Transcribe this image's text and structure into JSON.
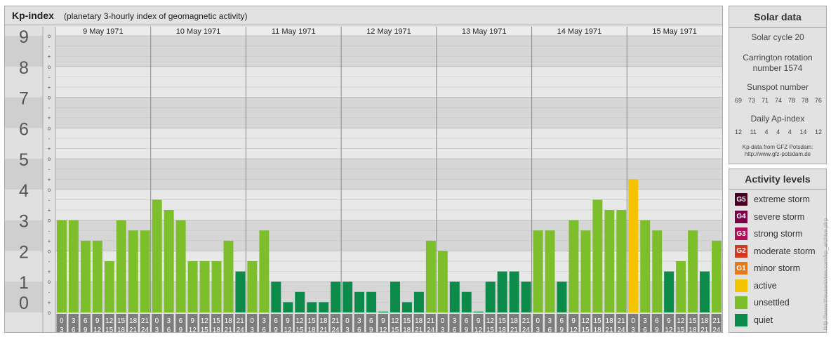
{
  "header": {
    "title": "Kp-index",
    "subtitle": "(planetary 3-hourly index of geomagnetic activity)"
  },
  "chart_data": {
    "type": "bar",
    "title": "Kp-index",
    "subtitle": "(planetary 3-hourly index of geomagnetic activity)",
    "ylim": [
      0,
      9
    ],
    "y_ticks": [
      "0",
      "1",
      "2",
      "3",
      "4",
      "5",
      "6",
      "7",
      "8",
      "9"
    ],
    "minor_tick_labels": [
      "o",
      "+",
      "-"
    ],
    "days": [
      "9 May 1971",
      "10 May 1971",
      "11 May 1971",
      "12 May 1971",
      "13 May 1971",
      "14 May 1971",
      "15 May 1971"
    ],
    "interval_start_labels": [
      "0",
      "3",
      "6",
      "9",
      "12",
      "15",
      "18",
      "21"
    ],
    "interval_end_labels": [
      "3",
      "6",
      "9",
      "12",
      "15",
      "18",
      "21",
      "24"
    ],
    "values": [
      3.0,
      3.0,
      2.333,
      2.333,
      1.667,
      3.0,
      2.667,
      2.667,
      3.667,
      3.333,
      3.0,
      1.667,
      1.667,
      1.667,
      2.333,
      1.333,
      1.667,
      2.667,
      1.0,
      0.333,
      0.667,
      0.333,
      0.333,
      1.0,
      1.0,
      0.667,
      0.667,
      0.0,
      1.0,
      0.333,
      0.667,
      2.333,
      2.0,
      1.0,
      0.667,
      0.0,
      1.0,
      1.333,
      1.333,
      1.0,
      2.667,
      2.667,
      1.0,
      3.0,
      2.667,
      3.667,
      3.333,
      3.333,
      4.333,
      3.0,
      2.667,
      1.333,
      1.667,
      2.667,
      1.333,
      2.333
    ],
    "level_colors": {
      "quiet": "#0b8a4a",
      "unsettled": "#7dbf2a",
      "active": "#f5c400"
    },
    "grid": true
  },
  "solar": {
    "title": "Solar data",
    "cycle": "Solar cycle 20",
    "carrington_line1": "Carrington rotation",
    "carrington_line2": "number 1574",
    "sunspot_title": "Sunspot number",
    "sunspot_values": [
      "69",
      "73",
      "71",
      "74",
      "78",
      "78",
      "76"
    ],
    "ap_title": "Daily Ap-index",
    "ap_values": [
      "12",
      "11",
      "4",
      "4",
      "4",
      "14",
      "12"
    ],
    "source_line1": "Kp-data from GFZ Potsdam:",
    "source_line2": "http://www.gfz-potsdam.de"
  },
  "activity": {
    "title": "Activity levels",
    "levels": [
      {
        "code": "G5",
        "label": "extreme storm",
        "color": "#4a0024"
      },
      {
        "code": "G4",
        "label": "severe storm",
        "color": "#7a0048"
      },
      {
        "code": "G3",
        "label": "strong storm",
        "color": "#b0105a"
      },
      {
        "code": "G2",
        "label": "moderate storm",
        "color": "#d23a20"
      },
      {
        "code": "G1",
        "label": "minor storm",
        "color": "#e57a1a"
      },
      {
        "code": "",
        "label": "active",
        "color": "#f5c400"
      },
      {
        "code": "",
        "label": "unsettled",
        "color": "#7dbf2a"
      },
      {
        "code": "",
        "label": "quiet",
        "color": "#0b8a4a"
      }
    ]
  },
  "watermark": "http://www.theusersview.com/kp_archive.php"
}
